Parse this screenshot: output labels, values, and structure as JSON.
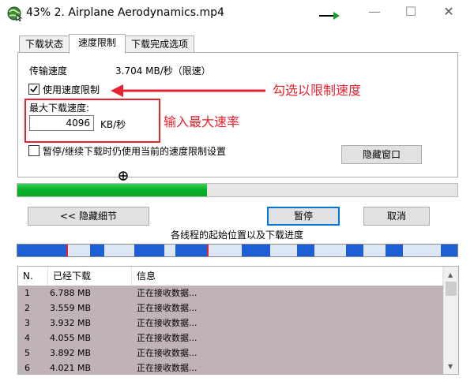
{
  "window": {
    "title": "43% 2. Airplane Aerodynamics.mp4",
    "minimize": "—",
    "maximize": "☐",
    "close": "✕"
  },
  "tabs": [
    {
      "label": "下载状态"
    },
    {
      "label": "速度限制"
    },
    {
      "label": "下载完成选项"
    }
  ],
  "speed": {
    "label": "传输速度",
    "value": "3.704  MB/秒（限速）"
  },
  "limit": {
    "checkbox_label": "使用速度限制",
    "checked": true,
    "max_label": "最大下载速度:",
    "max_value": "4096",
    "unit": "KB/秒",
    "pause_checkbox_label": "暂停/继续下载时仍使用当前的速度限制设置",
    "hide_window_button": "隐藏窗口"
  },
  "annotations": {
    "check_hint": "勾选以限制速度",
    "input_hint": "输入最大速率"
  },
  "progress": {
    "fraction": 0.43,
    "color": "#06b025"
  },
  "buttons": {
    "hide_details": "<< 隐藏细节",
    "pause": "暂停",
    "cancel": "取消"
  },
  "threads": {
    "caption": "各线程的起始位置以及下载进度"
  },
  "table": {
    "columns": [
      "N.",
      "已经下载",
      "信息"
    ],
    "rows": [
      {
        "n": "1",
        "downloaded": "6.788  MB",
        "info": "正在接收数据..."
      },
      {
        "n": "2",
        "downloaded": "3.559  MB",
        "info": "正在接收数据..."
      },
      {
        "n": "3",
        "downloaded": "3.932  MB",
        "info": "正在接收数据..."
      },
      {
        "n": "4",
        "downloaded": "4.055  MB",
        "info": "正在接收数据..."
      },
      {
        "n": "5",
        "downloaded": "3.892  MB",
        "info": "正在接收数据..."
      },
      {
        "n": "6",
        "downloaded": "4.021  MB",
        "info": "正在接收数据..."
      }
    ]
  },
  "colors": {
    "accent_red": "#e8212f",
    "row_highlight": "#bfb3b8",
    "thread_blue": "#1f5fd6"
  }
}
